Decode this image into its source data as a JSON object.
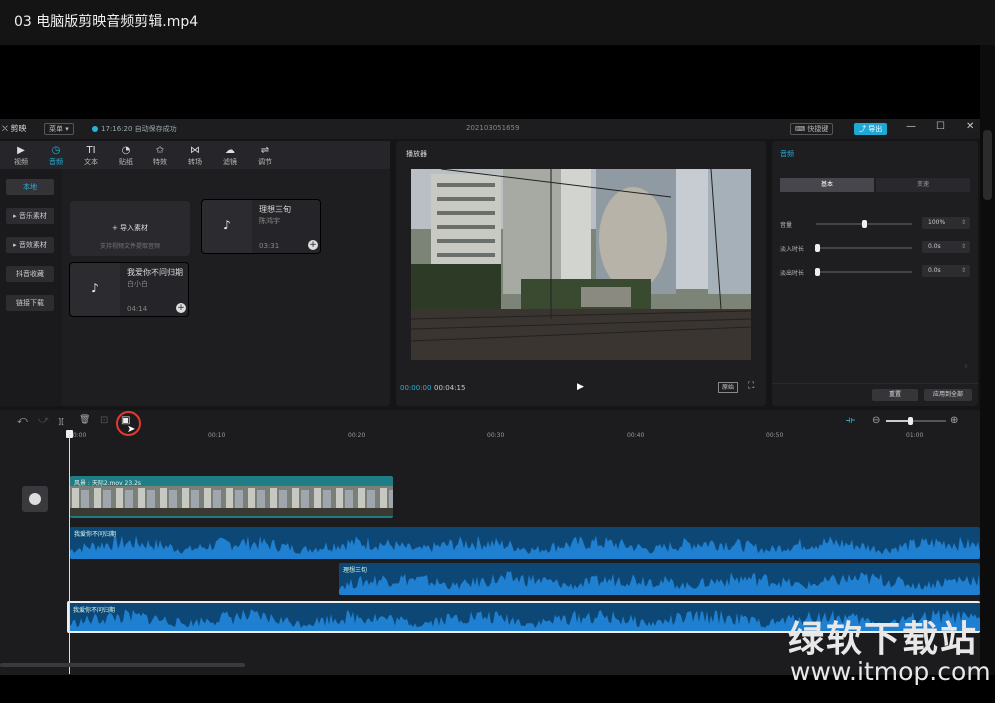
{
  "window": {
    "title": "03  电脑版剪映音频剪辑.mp4"
  },
  "app": {
    "logo": "剪映",
    "menu_label": "菜单",
    "saved_status": "17:16:20 自动保存成功",
    "project_name": "202103051659",
    "shortcut_label": "快捷键",
    "export_label": "导出",
    "win_min": "—",
    "win_max": "☐",
    "win_close": "✕"
  },
  "tabs": [
    {
      "icon": "▶",
      "label": "视频"
    },
    {
      "icon": "◷",
      "label": "音频"
    },
    {
      "icon": "TI",
      "label": "文本"
    },
    {
      "icon": "◔",
      "label": "贴纸"
    },
    {
      "icon": "✩",
      "label": "特效"
    },
    {
      "icon": "⋈",
      "label": "转场"
    },
    {
      "icon": "☁",
      "label": "滤镜"
    },
    {
      "icon": "⇌",
      "label": "调节"
    }
  ],
  "sidebar": {
    "items": [
      "本地",
      "▸ 音乐素材",
      "▸ 音效素材",
      "抖音收藏",
      "链接下载"
    ]
  },
  "import": {
    "title": "+  导入素材",
    "hint": "支持视频文件提取音频"
  },
  "media": [
    {
      "title": "理想三旬",
      "artist": "陈鸿宇",
      "duration": "03:31",
      "icon": "♪",
      "plus": "+"
    },
    {
      "title": "我爱你不问归期",
      "artist": "白小白",
      "duration": "04:14",
      "icon": "♪",
      "plus": "+"
    }
  ],
  "player": {
    "header": "播放器",
    "time_current": "00:00:00",
    "time_total": "00:04:15",
    "play_icon": "▶",
    "original_label": "原始",
    "fullscreen_icon": "⛶"
  },
  "audio_props": {
    "header": "音频",
    "tab_basic": "基本",
    "tab_speed": "变速",
    "volume_label": "音量",
    "volume_value": "100%",
    "fadein_label": "淡入时长",
    "fadein_value": "0.0s",
    "fadeout_label": "淡出时长",
    "fadeout_value": "0.0s",
    "spin": "⇕",
    "reset_label": "重置",
    "apply_all_label": "应用到全部",
    "volume_level": 0.5
  },
  "timeline": {
    "tools": [
      "⤺",
      "⤻",
      "][",
      "🗑",
      "⊡",
      "▣"
    ],
    "magnet_icon": "⟛",
    "zoom_out": "⊖",
    "zoom_in": "⊕",
    "zoom_level": 0.4,
    "ticks": [
      "00:00",
      "00:10",
      "00:20",
      "00:30",
      "00:40",
      "00:50",
      "01:00"
    ],
    "video_clip_label": "风景 : 天际2.mov   23.2s",
    "audio_clips": [
      "我爱你不问归期",
      "理想三旬",
      "我爱你不问归期"
    ]
  },
  "watermark": {
    "cn": "绿软下载站",
    "url": "www.itmop.com"
  },
  "colors": {
    "accent": "#22b1da",
    "audio_clip": "#0d4775",
    "video_clip": "#1f7d86",
    "highlight_ring": "#e03a32"
  }
}
